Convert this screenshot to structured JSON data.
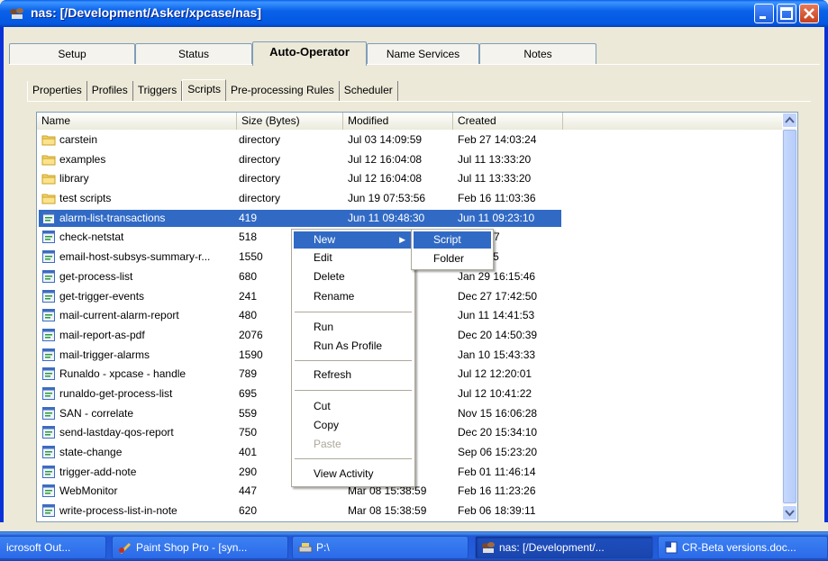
{
  "window": {
    "title": "nas: [/Development/Asker/xpcase/nas]"
  },
  "main_tabs": [
    {
      "label": "Setup"
    },
    {
      "label": "Status"
    },
    {
      "label": "Auto-Operator"
    },
    {
      "label": "Name Services"
    },
    {
      "label": "Notes"
    }
  ],
  "sub_tabs": [
    {
      "label": "Properties"
    },
    {
      "label": "Profiles"
    },
    {
      "label": "Triggers"
    },
    {
      "label": "Scripts"
    },
    {
      "label": "Pre-processing Rules"
    },
    {
      "label": "Scheduler"
    }
  ],
  "columns": {
    "name": "Name",
    "size": "Size (Bytes)",
    "modified": "Modified",
    "created": "Created"
  },
  "rows": [
    {
      "icon": "folder",
      "name": "carstein",
      "size": "directory",
      "modified": "Jul 03 14:09:59",
      "created": "Feb 27 14:03:24"
    },
    {
      "icon": "folder",
      "name": "examples",
      "size": "directory",
      "modified": "Jul 12 16:04:08",
      "created": "Jul 11 13:33:20"
    },
    {
      "icon": "folder",
      "name": "library",
      "size": "directory",
      "modified": "Jul 12 16:04:08",
      "created": "Jul 11 13:33:20"
    },
    {
      "icon": "folder",
      "name": "test scripts",
      "size": "directory",
      "modified": "Jun 19 07:53:56",
      "created": "Feb 16 11:03:36"
    },
    {
      "icon": "script",
      "name": "alarm-list-transactions",
      "size": "419",
      "modified": "Jun 11 09:48:30",
      "created": "Jun 11 09:23:10"
    },
    {
      "icon": "script",
      "name": "check-netstat",
      "size": "518",
      "modified": "",
      "created": "15:50:27"
    },
    {
      "icon": "script",
      "name": "email-host-subsys-summary-r...",
      "size": "1550",
      "modified": "",
      "created": "11:31:45"
    },
    {
      "icon": "script",
      "name": "get-process-list",
      "size": "680",
      "modified": "27",
      "created": "Jan 29 16:15:46"
    },
    {
      "icon": "script",
      "name": "get-trigger-events",
      "size": "241",
      "modified": "47",
      "created": "Dec 27 17:42:50"
    },
    {
      "icon": "script",
      "name": "mail-current-alarm-report",
      "size": "480",
      "modified": "21",
      "created": "Jun 11 14:41:53"
    },
    {
      "icon": "script",
      "name": "mail-report-as-pdf",
      "size": "2076",
      "modified": "29",
      "created": "Dec 20 14:50:39"
    },
    {
      "icon": "script",
      "name": "mail-trigger-alarms",
      "size": "1590",
      "modified": "59",
      "created": "Jan 10 15:43:33"
    },
    {
      "icon": "script",
      "name": "Runaldo - xpcase - handle",
      "size": "789",
      "modified": "01",
      "created": "Jul 12 12:20:01"
    },
    {
      "icon": "script",
      "name": "runaldo-get-process-list",
      "size": "695",
      "modified": "37",
      "created": "Jul 12 10:41:22"
    },
    {
      "icon": "script",
      "name": "SAN - correlate",
      "size": "559",
      "modified": "59",
      "created": "Nov 15 16:06:28"
    },
    {
      "icon": "script",
      "name": "send-lastday-qos-report",
      "size": "750",
      "modified": "59",
      "created": "Dec 20 15:34:10"
    },
    {
      "icon": "script",
      "name": "state-change",
      "size": "401",
      "modified": "59",
      "created": "Sep 06 15:23:20"
    },
    {
      "icon": "script",
      "name": "trigger-add-note",
      "size": "290",
      "modified": "59",
      "created": "Feb 01 11:46:14"
    },
    {
      "icon": "script",
      "name": "WebMonitor",
      "size": "447",
      "modified": "Mar 08 15:38:59",
      "created": "Feb 16 11:23:26"
    },
    {
      "icon": "script",
      "name": "write-process-list-in-note",
      "size": "620",
      "modified": "Mar 08 15:38:59",
      "created": "Feb 06 18:39:11"
    }
  ],
  "context_menu": {
    "new": "New",
    "edit": "Edit",
    "delete": "Delete",
    "rename": "Rename",
    "run": "Run",
    "run_as_profile": "Run As Profile",
    "refresh": "Refresh",
    "cut": "Cut",
    "copy": "Copy",
    "paste": "Paste",
    "view_activity": "View Activity"
  },
  "submenu": {
    "script": "Script",
    "folder": "Folder"
  },
  "taskbar": [
    {
      "label": "icrosoft Out...",
      "icon": "outlook-icon"
    },
    {
      "label": "Paint Shop Pro - [syn...",
      "icon": "paint-shop-pro-icon"
    },
    {
      "label": "P:\\",
      "icon": "drive-icon"
    },
    {
      "label": "nas: [/Development/...",
      "icon": "nas-app-icon"
    },
    {
      "label": "CR-Beta versions.doc...",
      "icon": "word-doc-icon"
    }
  ]
}
